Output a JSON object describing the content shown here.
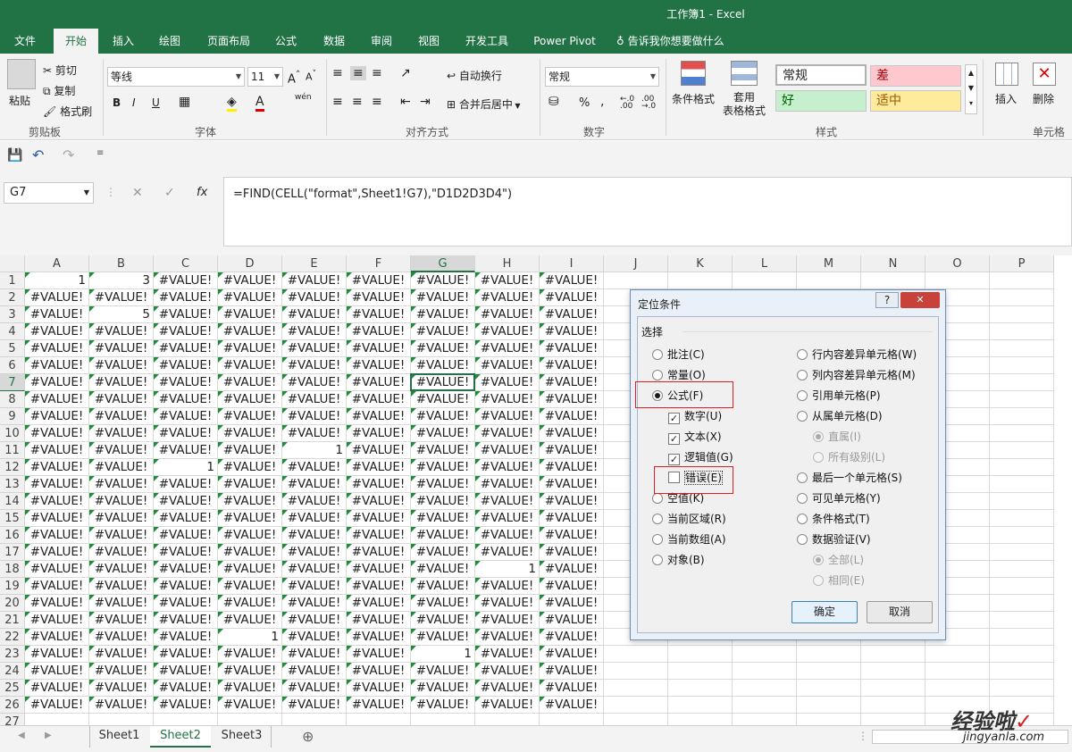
{
  "window": {
    "title": "工作簿1  -  Excel"
  },
  "ribbon_tabs": [
    "文件",
    "开始",
    "插入",
    "绘图",
    "页面布局",
    "公式",
    "数据",
    "审阅",
    "视图",
    "开发工具",
    "Power Pivot",
    "告诉我你想要做什么"
  ],
  "clipboard": {
    "paste": "粘贴",
    "cut": "剪切",
    "copy": "复制",
    "format_painter": "格式刷",
    "group": "剪贴板"
  },
  "font": {
    "name": "等线",
    "size": "11",
    "bold": "B",
    "italic": "I",
    "underline": "U",
    "group": "字体",
    "phonetic": "wén"
  },
  "alignment": {
    "wrap": "自动换行",
    "merge": "合并后居中",
    "group": "对齐方式"
  },
  "number": {
    "format": "常规",
    "percent": "%",
    "comma": ",",
    "group": "数字"
  },
  "styles": {
    "cond_format": "条件格式",
    "table_format": "套用\n表格格式",
    "normal": "常规",
    "bad": "差",
    "good": "好",
    "neutral": "适中",
    "group": "样式",
    "colors": {
      "bad_bg": "#ffc7ce",
      "bad_fg": "#9c0006",
      "good_bg": "#c6efce",
      "good_fg": "#006100",
      "neutral_bg": "#ffeb9c",
      "neutral_fg": "#9c5700"
    }
  },
  "cells_group": {
    "insert": "插入",
    "delete": "删除",
    "group": "单元格"
  },
  "formula_bar": {
    "name_box": "G7",
    "cancel": "✕",
    "enter": "✓",
    "fx": "fx",
    "formula": "=FIND(CELL(\"format\",Sheet1!G7),\"D1D2D3D4\")"
  },
  "columns": [
    "A",
    "B",
    "C",
    "D",
    "E",
    "F",
    "G",
    "H",
    "I",
    "J",
    "K",
    "L",
    "M",
    "N",
    "O",
    "P"
  ],
  "rows": [
    "1",
    "2",
    "3",
    "4",
    "5",
    "6",
    "7",
    "8",
    "9",
    "10",
    "11",
    "12",
    "13",
    "14",
    "15",
    "16",
    "17",
    "18",
    "19",
    "20",
    "21",
    "22",
    "23",
    "24",
    "25",
    "26",
    "27"
  ],
  "grid": {
    "error_text": "#VALUE!",
    "numbers": [
      {
        "row": 1,
        "col": "A",
        "value": "1"
      },
      {
        "row": 1,
        "col": "B",
        "value": "3"
      },
      {
        "row": 3,
        "col": "B",
        "value": "5"
      },
      {
        "row": 11,
        "col": "E",
        "value": "1"
      },
      {
        "row": 12,
        "col": "C",
        "value": "1"
      },
      {
        "row": 18,
        "col": "H",
        "value": "1"
      },
      {
        "row": 22,
        "col": "D",
        "value": "1"
      },
      {
        "row": 23,
        "col": "G",
        "value": "1"
      }
    ],
    "active_cell": "G7",
    "last_row": 26,
    "last_col": "I"
  },
  "sheets": [
    "Sheet1",
    "Sheet2",
    "Sheet3"
  ],
  "active_sheet": "Sheet2",
  "dialog": {
    "title": "定位条件",
    "help": "?",
    "close": "✕",
    "section": "选择",
    "left_options": [
      {
        "label": "批注(C)",
        "checked": false
      },
      {
        "label": "常量(O)",
        "checked": false
      },
      {
        "label": "公式(F)",
        "checked": true
      }
    ],
    "sub_checks": [
      {
        "label": "数字(U)",
        "checked": true
      },
      {
        "label": "文本(X)",
        "checked": true
      },
      {
        "label": "逻辑值(G)",
        "checked": true
      },
      {
        "label": "错误(E)",
        "checked": false
      }
    ],
    "left_options2": [
      "空值(K)",
      "当前区域(R)",
      "当前数组(A)",
      "对象(B)"
    ],
    "right_options": [
      "行内容差异单元格(W)",
      "列内容差异单元格(M)",
      "引用单元格(P)",
      "从属单元格(D)"
    ],
    "right_sub1": [
      "直属(I)",
      "所有级别(L)"
    ],
    "right_options2": [
      "最后一个单元格(S)",
      "可见单元格(Y)",
      "条件格式(T)",
      "数据验证(V)"
    ],
    "right_sub2": [
      "全部(L)",
      "相同(E)"
    ],
    "ok": "确定",
    "cancel": "取消"
  },
  "watermark": {
    "line1": "经验啦",
    "check": "✓",
    "line2": "jingyanla.com"
  }
}
